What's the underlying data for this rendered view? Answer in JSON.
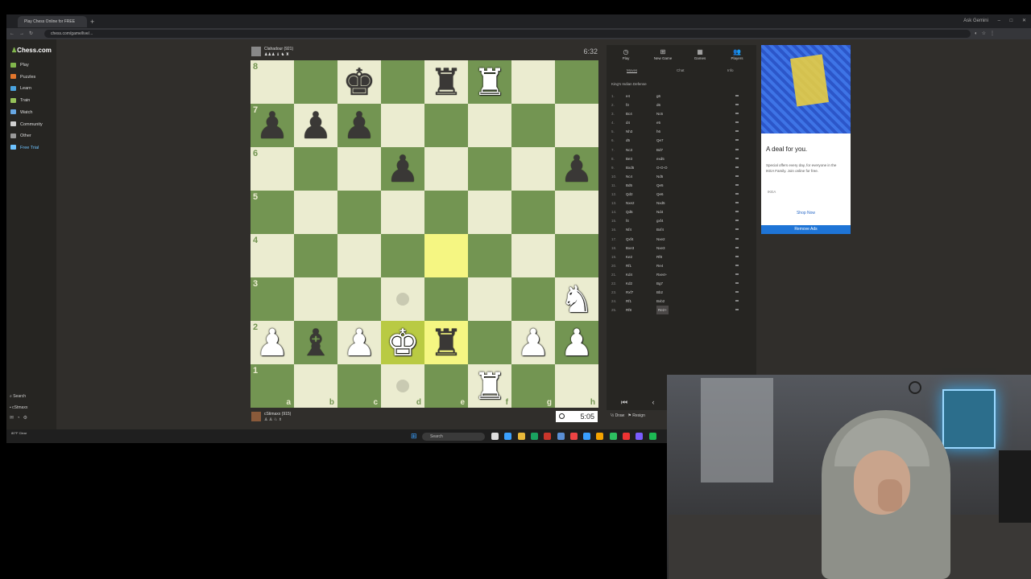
{
  "browser": {
    "tab_title": "Play Chess Online for FREE",
    "url": "chess.com/game/live/...",
    "profile_label": "Ask Gemini"
  },
  "sidebar": {
    "logo_main": "Chess",
    "logo_suffix": ".com",
    "items": [
      {
        "label": "Play",
        "color": "#81b64c"
      },
      {
        "label": "Puzzles",
        "color": "#e3762c"
      },
      {
        "label": "Learn",
        "color": "#4aa3df"
      },
      {
        "label": "Train",
        "color": "#95c25a"
      },
      {
        "label": "Watch",
        "color": "#67a7e3"
      },
      {
        "label": "Community",
        "color": "#d0d0d0"
      },
      {
        "label": "Other",
        "color": "#9a9a9a"
      },
      {
        "label": "Free Trial",
        "color": "#6ec3ff"
      }
    ],
    "search_label": "Search",
    "username": "cStmaxx"
  },
  "players": {
    "opponent_name": "Clahadour (921)",
    "opponent_clock": "6:32",
    "me_name": "cStimaxx (915)",
    "my_clock": "5:05"
  },
  "board": {
    "ranks": [
      "8",
      "7",
      "6",
      "5",
      "4",
      "3",
      "2",
      "1"
    ],
    "files": [
      "a",
      "b",
      "c",
      "d",
      "e",
      "f",
      "g",
      "h"
    ],
    "pieces": [
      {
        "sq": "c8",
        "p": "k",
        "color": "black"
      },
      {
        "sq": "e8",
        "p": "r",
        "color": "black"
      },
      {
        "sq": "f8",
        "p": "r",
        "color": "white"
      },
      {
        "sq": "a7",
        "p": "p",
        "color": "black"
      },
      {
        "sq": "b7",
        "p": "p",
        "color": "black"
      },
      {
        "sq": "c7",
        "p": "p",
        "color": "black"
      },
      {
        "sq": "d6",
        "p": "p",
        "color": "black"
      },
      {
        "sq": "h6",
        "p": "p",
        "color": "black"
      },
      {
        "sq": "h3",
        "p": "n",
        "color": "white"
      },
      {
        "sq": "a2",
        "p": "p",
        "color": "white"
      },
      {
        "sq": "b2",
        "p": "b",
        "color": "black"
      },
      {
        "sq": "c2",
        "p": "p",
        "color": "white"
      },
      {
        "sq": "d2",
        "p": "k",
        "color": "white"
      },
      {
        "sq": "e2",
        "p": "r",
        "color": "black"
      },
      {
        "sq": "g2",
        "p": "p",
        "color": "white"
      },
      {
        "sq": "h2",
        "p": "p",
        "color": "white"
      },
      {
        "sq": "f1",
        "p": "r",
        "color": "white"
      }
    ],
    "highlights": [
      "e4",
      "d2",
      "e2"
    ],
    "hints": [
      "d3",
      "d1"
    ]
  },
  "panel": {
    "tabs": [
      "Play",
      "New Game",
      "Games",
      "Players"
    ],
    "subtabs": [
      "Moves",
      "Chat",
      "Info"
    ],
    "opening": "King's Indian Defense",
    "moves": [
      {
        "n": "1.",
        "w": "e4",
        "b": "g6"
      },
      {
        "n": "2.",
        "w": "f3",
        "b": "d6"
      },
      {
        "n": "3.",
        "w": "Bc4",
        "b": "Nc6"
      },
      {
        "n": "4.",
        "w": "d4",
        "b": "e5"
      },
      {
        "n": "5.",
        "w": "Nh3",
        "b": "h6"
      },
      {
        "n": "6.",
        "w": "d5",
        "b": "Qe7"
      },
      {
        "n": "7.",
        "w": "Nc3",
        "b": "Bd7"
      },
      {
        "n": "8.",
        "w": "Be3",
        "b": "exd5"
      },
      {
        "n": "9.",
        "w": "Bxd5",
        "b": "O-O-O"
      },
      {
        "n": "10.",
        "w": "Nc4",
        "b": "Nd5"
      },
      {
        "n": "11.",
        "w": "Bd5",
        "b": "Qe5"
      },
      {
        "n": "12.",
        "w": "Qd2",
        "b": "Qe6"
      },
      {
        "n": "13.",
        "w": "Nxe2",
        "b": "Nxd5"
      },
      {
        "n": "14.",
        "w": "Qd5",
        "b": "Nd4"
      },
      {
        "n": "15.",
        "w": "f4",
        "b": "gxf4"
      },
      {
        "n": "16.",
        "w": "Nf4",
        "b": "Bxf4"
      },
      {
        "n": "17.",
        "w": "Qxf4",
        "b": "Nxe2"
      },
      {
        "n": "18.",
        "w": "Bxe3",
        "b": "Nxe3"
      },
      {
        "n": "19.",
        "w": "Ke2",
        "b": "Rf8"
      },
      {
        "n": "20.",
        "w": "Rf1",
        "b": "Re4"
      },
      {
        "n": "21.",
        "w": "Kd4",
        "b": "Rxe4+"
      },
      {
        "n": "22.",
        "w": "Kd2",
        "b": "Bg7"
      },
      {
        "n": "23.",
        "w": "Rxf7",
        "b": "Bb2"
      },
      {
        "n": "24.",
        "w": "Rf1",
        "b": "Bxb2"
      },
      {
        "n": "25.",
        "w": "Rf8",
        "b": "Re2+"
      }
    ],
    "draw_label": "Draw",
    "resign_label": "Resign"
  },
  "ad": {
    "title": "A deal for you.",
    "text": "Special offers every day, for everyone in the IKEA Family. Join online for free.",
    "brand": "IKEA",
    "shop": "Shop Now",
    "remove": "Remove Ads"
  },
  "taskbar": {
    "search_placeholder": "Search",
    "weather": "80°F Clear",
    "icon_colors": [
      "#ddd",
      "#3aa0ff",
      "#e8b83a",
      "#1aa260",
      "#c9352b",
      "#5a8fd6",
      "#e44",
      "#3aa0ff",
      "#f4a300",
      "#2dbf60",
      "#e33",
      "#7a5cff",
      "#1db954"
    ]
  }
}
